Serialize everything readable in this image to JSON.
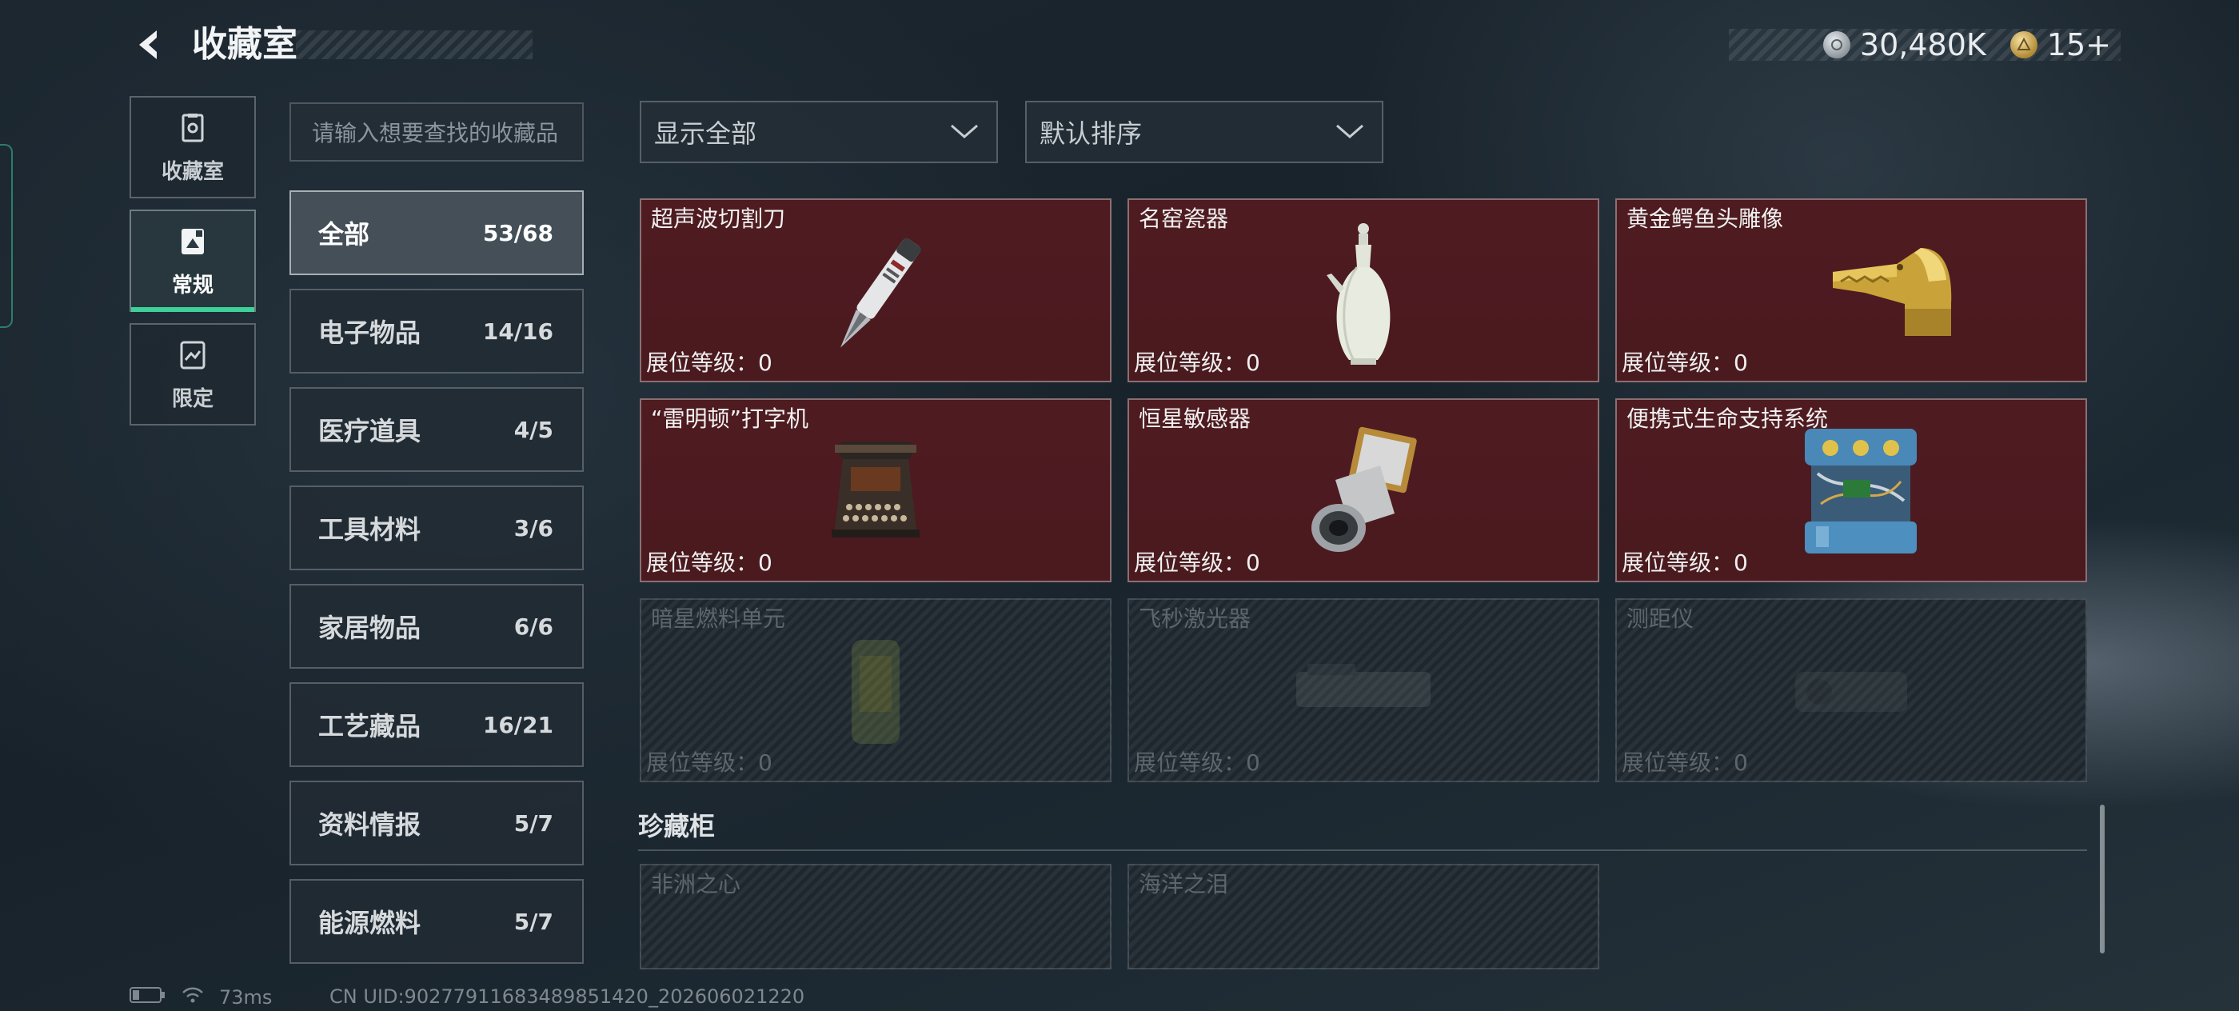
{
  "header": {
    "title": "收藏室",
    "currency": [
      {
        "icon": "silver-coin-icon",
        "value": "30,480K"
      },
      {
        "icon": "gold-ticket-icon",
        "value": "15+"
      }
    ]
  },
  "rail": [
    {
      "label": "收藏室",
      "icon": "vault-icon",
      "active": false
    },
    {
      "label": "常规",
      "icon": "collection-card-icon",
      "active": true
    },
    {
      "label": "限定",
      "icon": "limited-card-icon",
      "active": false
    }
  ],
  "search": {
    "placeholder": "请输入想要查找的收藏品"
  },
  "categories": [
    {
      "name": "全部",
      "count": "53/68"
    },
    {
      "name": "电子物品",
      "count": "14/16"
    },
    {
      "name": "医疗道具",
      "count": "4/5"
    },
    {
      "name": "工具材料",
      "count": "3/6"
    },
    {
      "name": "家居物品",
      "count": "6/6"
    },
    {
      "name": "工艺藏品",
      "count": "16/21"
    },
    {
      "name": "资料情报",
      "count": "5/7"
    },
    {
      "name": "能源燃料",
      "count": "5/7"
    }
  ],
  "filters": {
    "display": "显示全部",
    "sort": "默认排序"
  },
  "items": [
    {
      "name": "超声波切割刀",
      "level": "展位等级：0",
      "owned": true,
      "icon": "ultrasonic-blade-icon"
    },
    {
      "name": "名窑瓷器",
      "level": "展位等级：0",
      "owned": true,
      "icon": "porcelain-vase-icon"
    },
    {
      "name": "黄金鳄鱼头雕像",
      "level": "展位等级：0",
      "owned": true,
      "icon": "golden-crocodile-statue-icon"
    },
    {
      "name": "“雷明顿”打字机",
      "level": "展位等级：0",
      "owned": true,
      "icon": "typewriter-icon"
    },
    {
      "name": "恒星敏感器",
      "level": "展位等级：0",
      "owned": true,
      "icon": "star-sensor-icon"
    },
    {
      "name": "便携式生命支持系统",
      "level": "展位等级：0",
      "owned": true,
      "icon": "life-support-system-icon"
    },
    {
      "name": "暗星燃料单元",
      "level": "展位等级：0",
      "owned": false,
      "icon": "fuel-cell-icon"
    },
    {
      "name": "飞秒激光器",
      "level": "展位等级：0",
      "owned": false,
      "icon": "laser-device-icon"
    },
    {
      "name": "测距仪",
      "level": "展位等级：0",
      "owned": false,
      "icon": "rangefinder-icon"
    }
  ],
  "cabinet": {
    "title": "珍藏柜",
    "items": [
      {
        "name": "非洲之心",
        "owned": false
      },
      {
        "name": "海洋之泪",
        "owned": false
      }
    ]
  },
  "status": {
    "ping": "73ms",
    "uid": "CN UID:90277911683489851420_202606021220"
  }
}
